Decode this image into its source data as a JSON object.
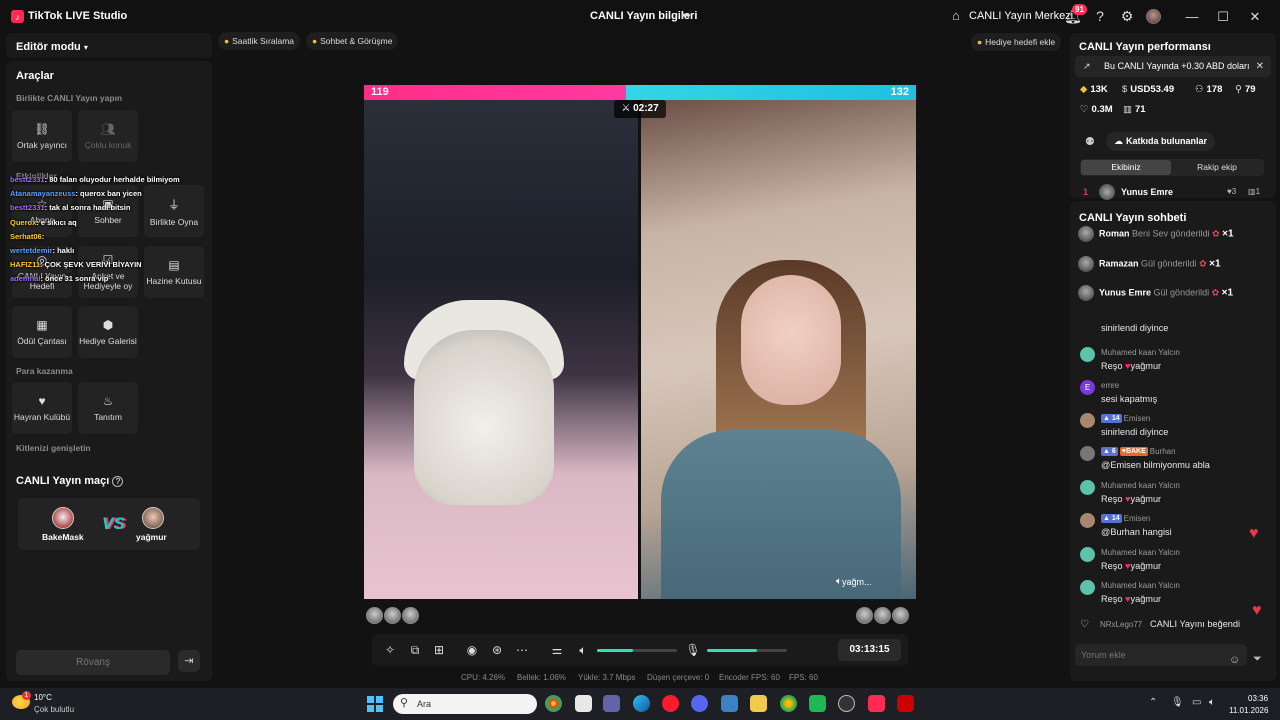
{
  "titlebar": {
    "app_title": "TikTok LIVE Studio",
    "live_info": "CANLI Yayın bilgileri",
    "live_center": "CANLI Yayın Merkezi",
    "notif_count": "91"
  },
  "left": {
    "editor_mode": "Editör modu",
    "tools_title": "Araçlar",
    "together_title": "Birlikte CANLI Yayın yapın",
    "cohost": "Ortak yayıncı",
    "multi_guest": "Çoklu konuk",
    "activities_title": "Etkinlikler",
    "subscriber": "Abone",
    "comment_together": "Sohber",
    "play_together": "Birlikte Oyna",
    "live_goal": "CANLI Yayın Hedefi",
    "poll_gift": "Anket ve Hediyeyle oy",
    "treasure_box": "Hazine Kutusu",
    "reward_bag": "Ödül Çantası",
    "gift_gallery": "Hediye Galerisi",
    "earn_title": "Para kazanma",
    "fan_club": "Hayran Kulübü",
    "promo": "Tanıtım",
    "expand_title": "Kitlenizi genişletin",
    "match_title": "CANLI Yayın maçı",
    "player1": "BakeMask",
    "player2": "yağmur",
    "vs": "VS",
    "rematch": "Rövanş"
  },
  "overlay_chat": [
    {
      "user": "bestt2331",
      "text": ": 80 falan oluyodur herhalde bilmiyom"
    },
    {
      "user": "Atanamayanzeuss",
      "text": ": querox ban yicen"
    },
    {
      "user": "bestt2331",
      "text": ": tak al sonra hadi bitsin"
    },
    {
      "user": "Querox",
      "text": ": e sıkıcı aq"
    },
    {
      "user": "Serhat06",
      "text": ":"
    },
    {
      "user": "wertetdemir",
      "text": ": haklı"
    },
    {
      "user": "HAFIZ11",
      "text": ": ÇOK ŞEVK VERİVİ BİYAYIN"
    },
    {
      "user": "ademhal",
      "text": ": önce 31 sonra vip"
    }
  ],
  "chips": {
    "hourly_rank": "Saatlik Sıralama",
    "chat_meet": "Sohbet & Görüşme",
    "gift_goal": "Hediye hedefi ekle"
  },
  "stream": {
    "score_left": "119",
    "score_right": "132",
    "timer": "02:27",
    "guest_name": "yağm..."
  },
  "controls": {
    "live_time": "03:13:15",
    "mic_volume": 0.45,
    "speaker_volume": 0.62
  },
  "stats": {
    "cpu": "CPU:  4.26%",
    "memory": "Bellek:  1.06%",
    "upload": "Yükle:  3.7 Mbps",
    "dropped": "Düşen çerçeve:  0",
    "encoder_fps": "Encoder FPS:  60",
    "fps": "FPS:  60"
  },
  "right": {
    "perf_title": "CANLI Yayın performansı",
    "revenue_note": "Bu CANLI Yayında +0.30 ABD doları",
    "m_coins": "13K",
    "m_usd": "USD53.49",
    "m_viewers": "178",
    "m_new": "79",
    "m_likes": "0.3M",
    "m_gifts": "71",
    "contributors": "Katkıda bulunanlar",
    "tab_our": "Ekibiniz",
    "tab_rival": "Rakip ekip",
    "rank_num": "1",
    "rank_name": "Yunus Emre",
    "rank_s1": "3",
    "rank_s2": "1",
    "chat_title": "CANLI Yayın sohbeti",
    "gifts": [
      {
        "name": "Roman",
        "text": "Beni Sev gönderildi",
        "count": "×1"
      },
      {
        "name": "Ramazan",
        "text": "Gül gönderildi",
        "count": "×1"
      },
      {
        "name": "Yunus Emre",
        "text": "Gül gönderildi",
        "count": "×1"
      }
    ],
    "messages": [
      {
        "user": "",
        "text": "sinirlendi diyince"
      },
      {
        "user": "Muhamed kaan Yalcın",
        "text": "Reşo",
        "text2": "yağmur"
      },
      {
        "user": "emre",
        "text": "sesi kapatmış"
      },
      {
        "user": "Emisen",
        "level": "14",
        "text": "sinirlendi diyince"
      },
      {
        "user": "Burhan",
        "level": "6",
        "tag": "BAKE",
        "text": "@Emisen bilmiyonmu abla"
      },
      {
        "user": "Muhamed kaan Yalcın",
        "text": "Reşo",
        "text2": "yağmur"
      },
      {
        "user": "Emisen",
        "level": "14",
        "text": "@Burhan hangisi"
      },
      {
        "user": "Muhamed kaan Yalcın",
        "text": "Reşo",
        "text2": "yağmur"
      },
      {
        "user": "Muhamed kaan Yalcın",
        "text": "Reşo",
        "text2": "yağmur"
      }
    ],
    "like_user": "NRxLego77",
    "like_text": "CANLI Yayını beğendi",
    "comment_placeholder": "Yorum ekle"
  },
  "taskbar": {
    "temp": "10°C",
    "weather": "Çok bulutlu",
    "weather_badge": "1",
    "search": "Ara",
    "time": "03:36",
    "date": "11.01.2026"
  }
}
